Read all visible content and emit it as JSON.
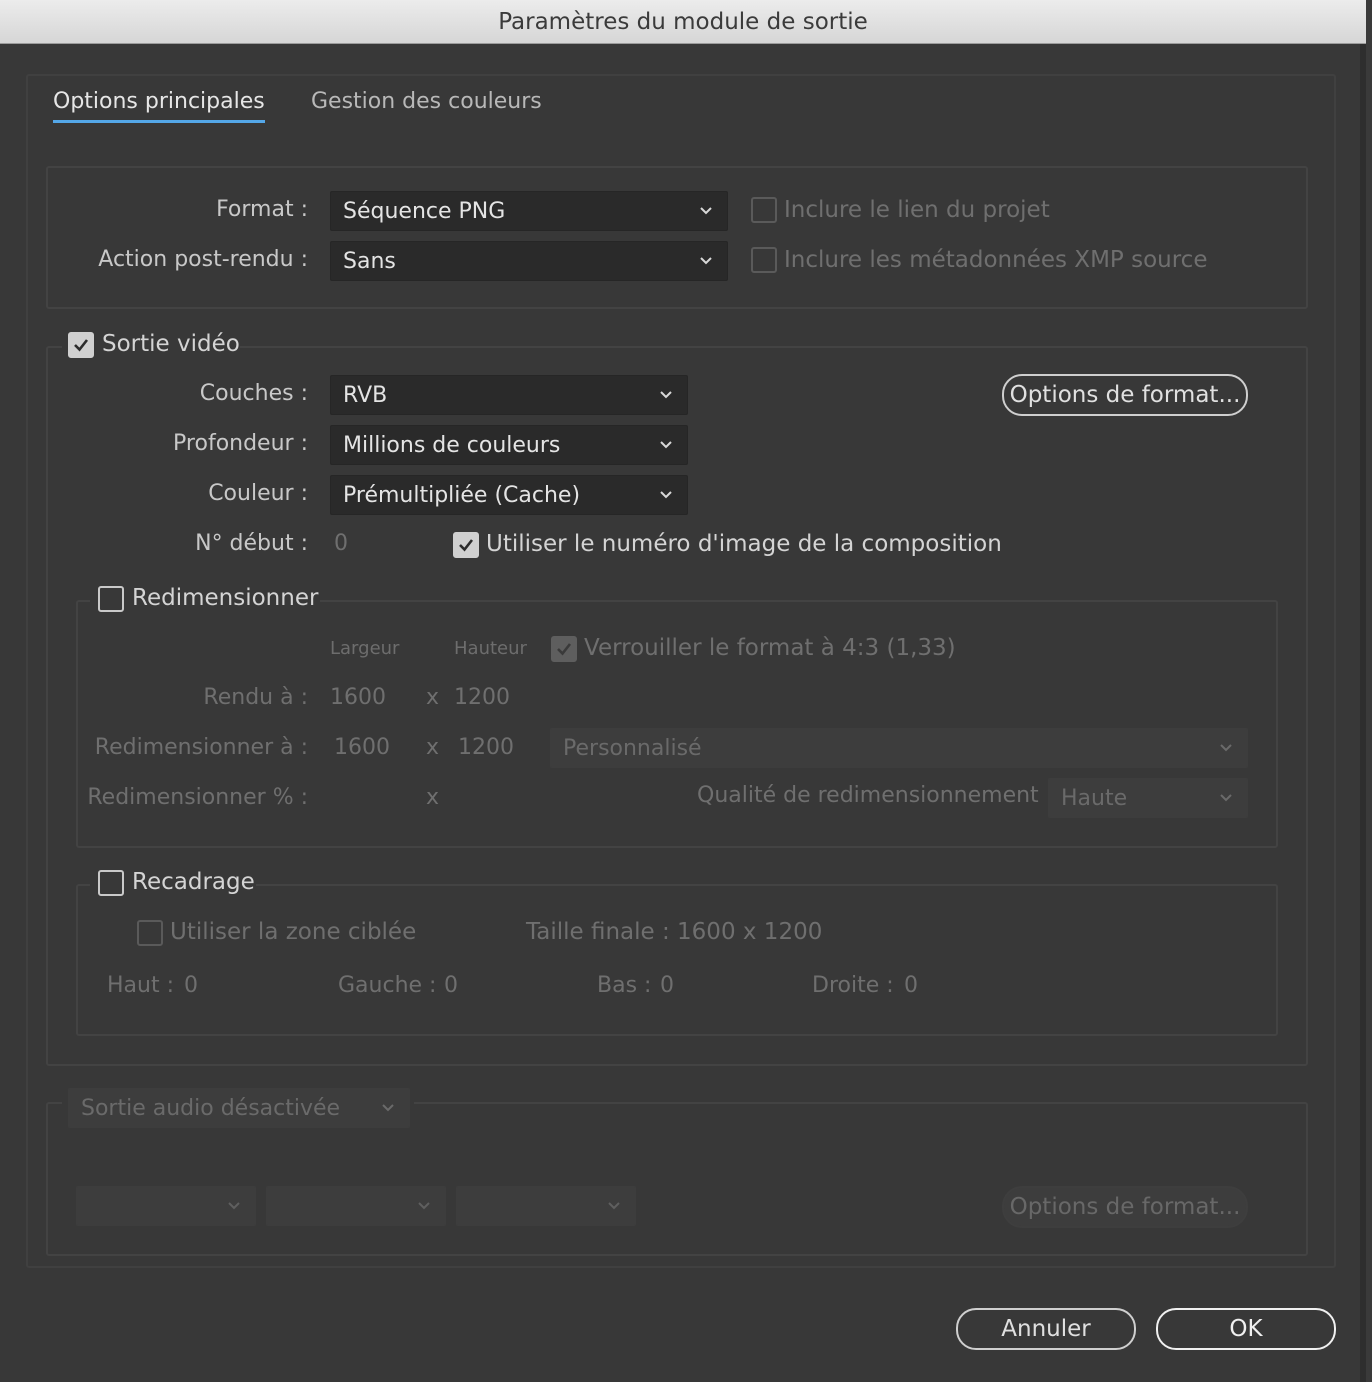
{
  "window": {
    "title": "Paramètres du module de sortie"
  },
  "tabs": [
    {
      "label": "Options principales",
      "active": true
    },
    {
      "label": "Gestion des couleurs",
      "active": false
    }
  ],
  "format_section": {
    "format_label": "Format :",
    "format_value": "Séquence PNG",
    "post_render_label": "Action post-rendu :",
    "post_render_value": "Sans",
    "include_project_link": {
      "label": "Inclure le lien du projet",
      "checked": false,
      "enabled": false
    },
    "include_xmp": {
      "label": "Inclure les métadonnées XMP source",
      "checked": false,
      "enabled": false
    }
  },
  "video": {
    "enabled_label": "Sortie vidéo",
    "enabled": true,
    "channels_label": "Couches :",
    "channels_value": "RVB",
    "depth_label": "Profondeur :",
    "depth_value": "Millions de couleurs",
    "color_label": "Couleur :",
    "color_value": "Prémultipliée (Cache)",
    "start_label": "N° début :",
    "start_value": "0",
    "use_comp_frame": {
      "label": "Utiliser le numéro d'image de la composition",
      "checked": true
    },
    "format_options_button": "Options de format..."
  },
  "resize": {
    "label": "Redimensionner",
    "checked": false,
    "width_header": "Largeur",
    "height_header": "Hauteur",
    "lock_aspect": {
      "label": "Verrouiller le format à 4:3 (1,33)",
      "checked": true
    },
    "rendered_label": "Rendu à :",
    "rendered_w": "1600",
    "rendered_h": "1200",
    "resize_to_label": "Redimensionner à :",
    "resize_w": "1600",
    "resize_h": "1200",
    "preset_value": "Personnalisé",
    "percent_label": "Redimensionner % :",
    "x": "x",
    "quality_label": "Qualité de redimensionnement :",
    "quality_value": "Haute"
  },
  "crop": {
    "label": "Recadrage",
    "checked": false,
    "use_roi": {
      "label": "Utiliser la zone ciblée",
      "checked": false
    },
    "final_size": "Taille finale : 1600 x 1200",
    "top_label": "Haut :",
    "top_value": "0",
    "left_label": "Gauche :",
    "left_value": "0",
    "bottom_label": "Bas :",
    "bottom_value": "0",
    "right_label": "Droite :",
    "right_value": "0"
  },
  "audio": {
    "mode_value": "Sortie audio désactivée",
    "format_options_button": "Options de format..."
  },
  "footer": {
    "cancel": "Annuler",
    "ok": "OK"
  }
}
